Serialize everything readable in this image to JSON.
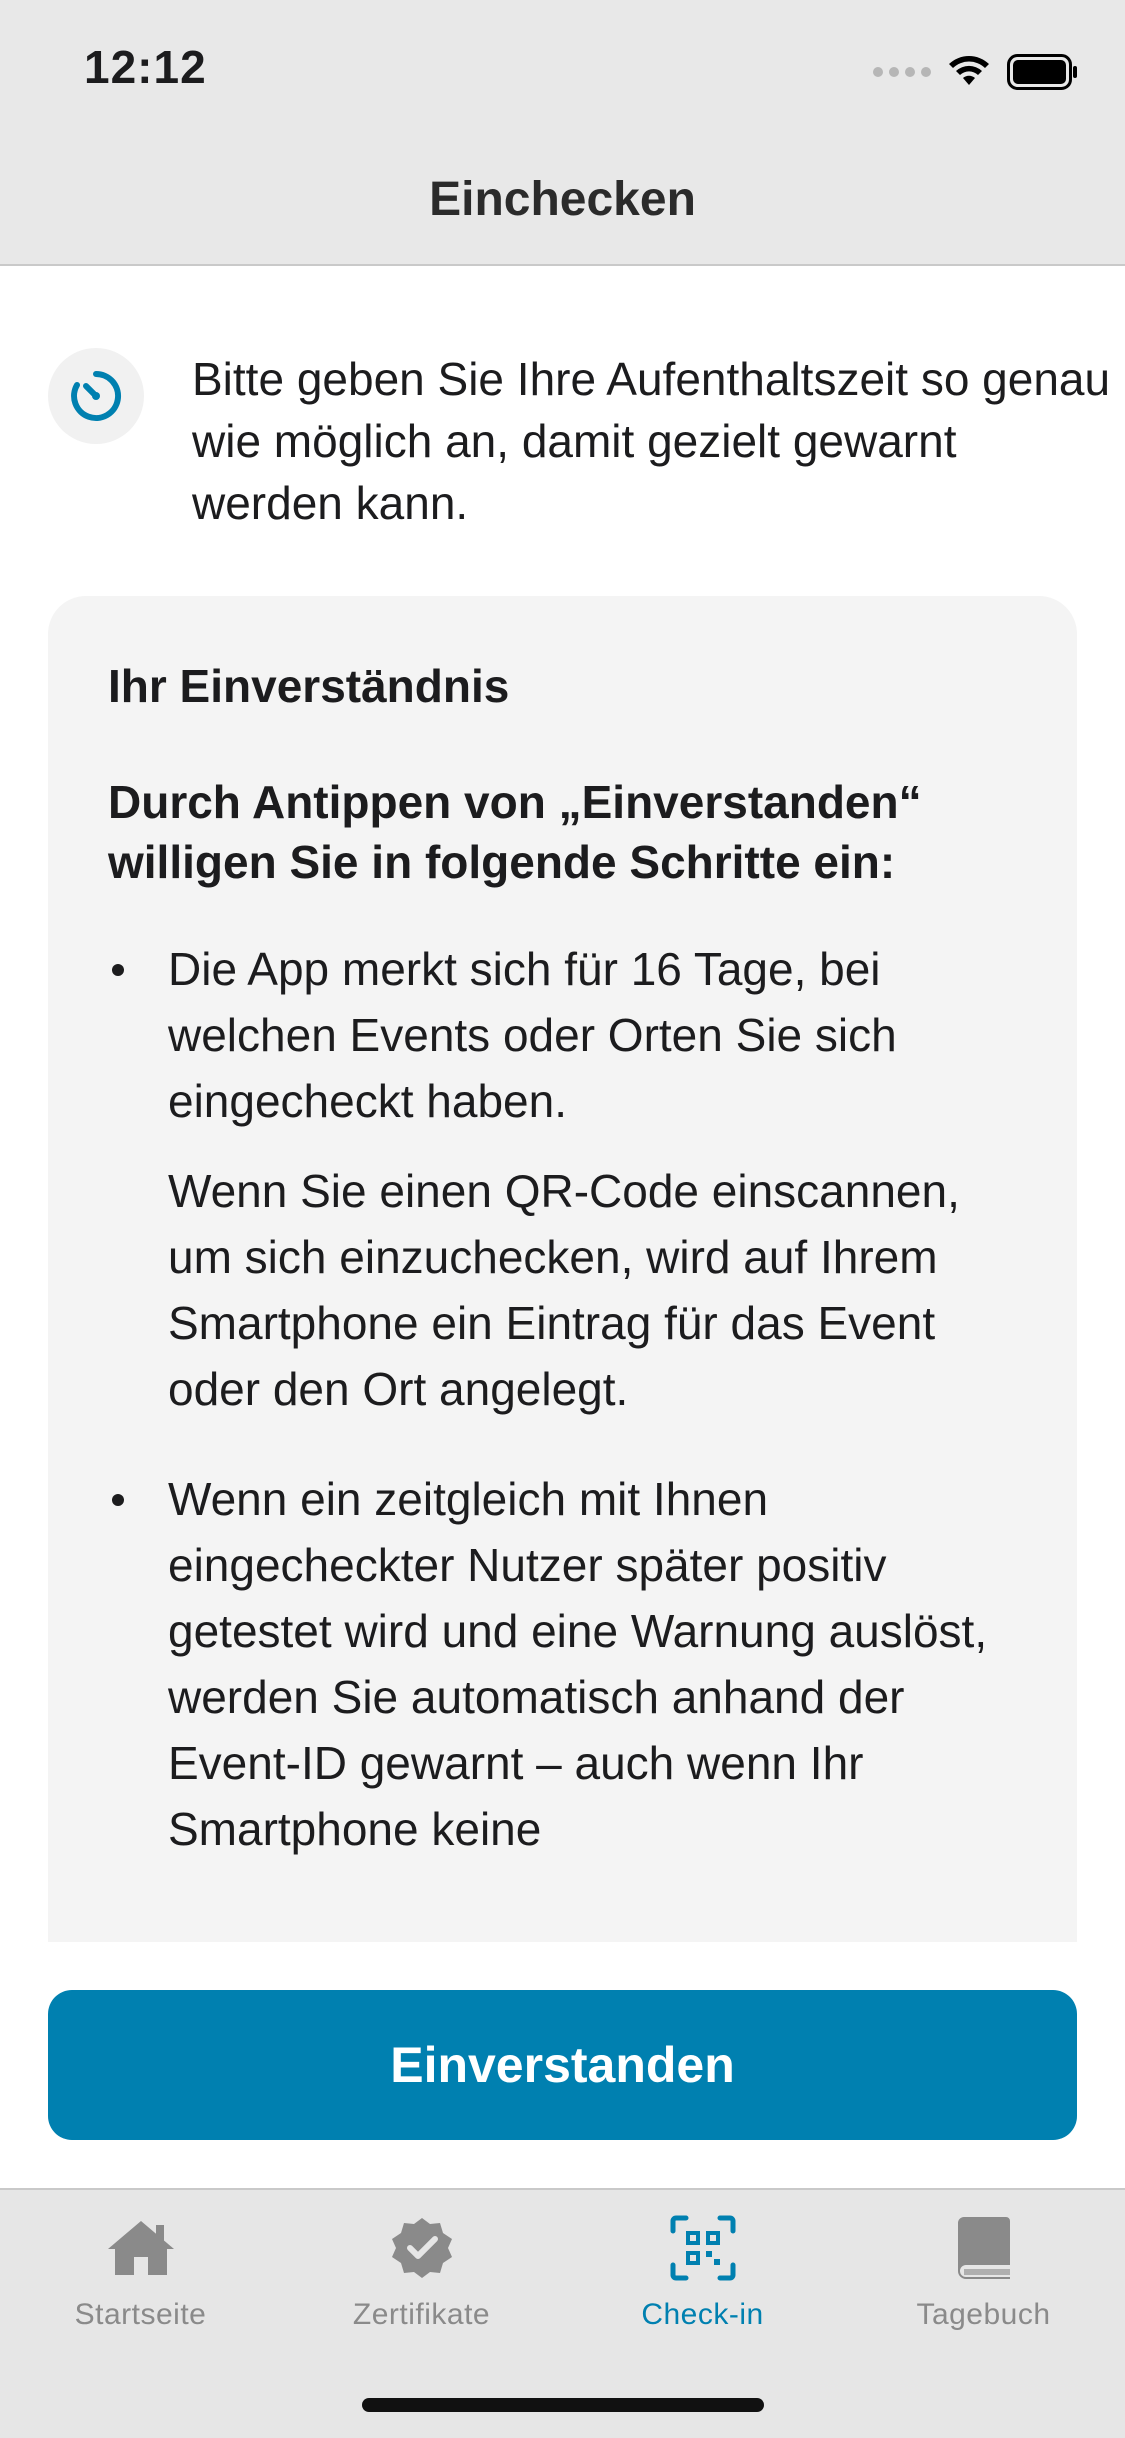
{
  "status": {
    "time": "12:12"
  },
  "nav": {
    "title": "Einchecken"
  },
  "intro": {
    "icon": "timer-icon",
    "text": "Bitte geben Sie Ihre Aufenthaltszeit so genau wie möglich an, damit gezielt gewarnt werden kann."
  },
  "consent": {
    "title": "Ihr Einverständnis",
    "lead": "Durch Antippen von „Einverstanden“ willigen Sie in folgende Schritte ein:",
    "bullets": [
      {
        "p1": "Die App merkt sich für 16 Tage, bei welchen Events oder Orten Sie sich eingecheckt haben.",
        "p2": "Wenn Sie einen QR-Code einscannen, um sich einzuchecken, wird auf Ihrem Smartphone ein Eintrag für das Event oder den Ort angelegt."
      },
      {
        "p1": "Wenn ein zeitgleich mit Ihnen eingecheckter Nutzer später positiv getestet wird und eine Warnung auslöst, werden Sie automatisch anhand der Event-ID gewarnt – auch wenn Ihr Smartphone keine"
      }
    ]
  },
  "action": {
    "agree_label": "Einverstanden"
  },
  "tabs": [
    {
      "label": "Startseite",
      "icon": "home-icon",
      "active": false
    },
    {
      "label": "Zertifikate",
      "icon": "certificate-icon",
      "active": false
    },
    {
      "label": "Check-in",
      "icon": "qr-code-icon",
      "active": true
    },
    {
      "label": "Tagebuch",
      "icon": "book-icon",
      "active": false
    }
  ],
  "colors": {
    "accent": "#0080b0",
    "inactive": "#8a8a8a",
    "card": "#f4f4f4"
  }
}
